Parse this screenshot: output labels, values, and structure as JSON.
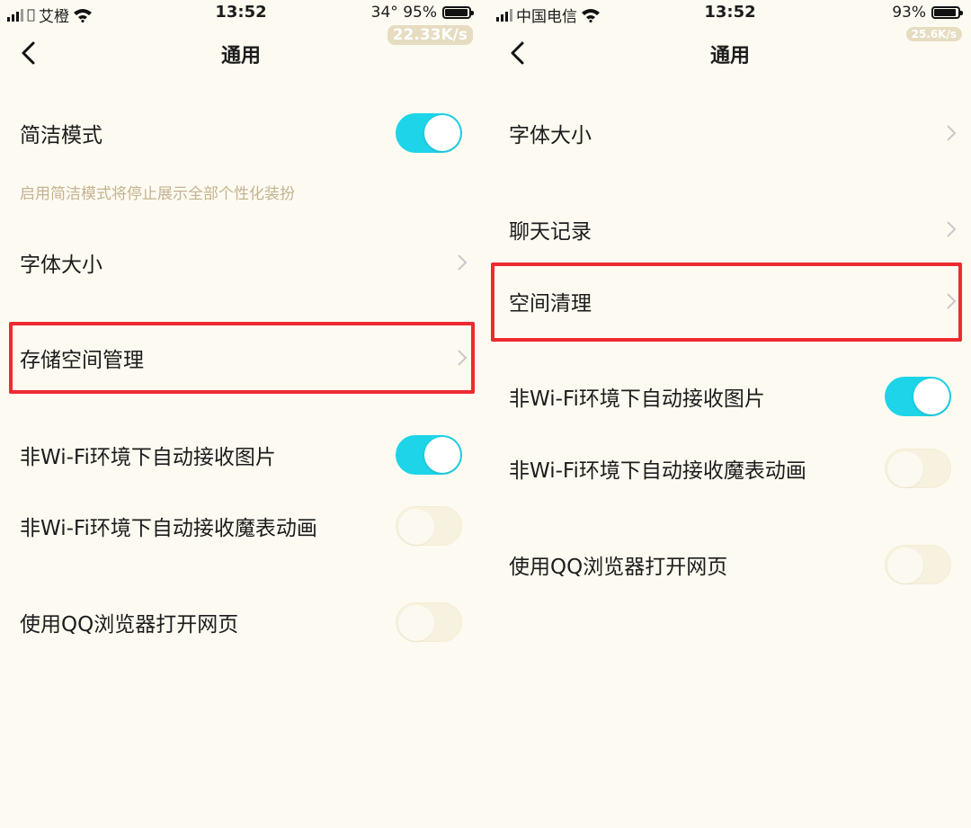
{
  "left": {
    "statusbar": {
      "carrier": "艾橙",
      "time": "13:52",
      "status": "34° 95%",
      "battery_level": 0.95,
      "speed": "22.33K/s"
    },
    "nav": {
      "title": "通用"
    },
    "rows": {
      "simple_mode": {
        "label": "简洁模式",
        "on": true
      },
      "simple_mode_hint": "启用简洁模式将停止展示全部个性化装扮",
      "font_size": {
        "label": "字体大小"
      },
      "storage": {
        "label": "存储空间管理"
      },
      "auto_image": {
        "label": "非Wi-Fi环境下自动接收图片",
        "on": true
      },
      "auto_emoji": {
        "label": "非Wi-Fi环境下自动接收魔表动画",
        "on": false
      },
      "qq_browser": {
        "label": "使用QQ浏览器打开网页",
        "on": false
      }
    }
  },
  "right": {
    "statusbar": {
      "carrier": "中国电信",
      "time": "13:52",
      "status": "93%",
      "battery_level": 0.93,
      "speed": "25.6K/s"
    },
    "nav": {
      "title": "通用"
    },
    "rows": {
      "font_size": {
        "label": "字体大小"
      },
      "chat_history": {
        "label": "聊天记录"
      },
      "space_cleanup": {
        "label": "空间清理"
      },
      "auto_image": {
        "label": "非Wi-Fi环境下自动接收图片",
        "on": true
      },
      "auto_emoji": {
        "label": "非Wi-Fi环境下自动接收魔表动画",
        "on": false
      },
      "qq_browser": {
        "label": "使用QQ浏览器打开网页",
        "on": false
      }
    }
  },
  "colors": {
    "background": "#fdfbf1",
    "toggle_on": "#1ed4e8",
    "highlight": "#ee2a31",
    "hint_text": "#c4b292"
  },
  "icons": [
    "signal-icon",
    "apple-icon",
    "wifi-icon",
    "battery-icon",
    "back-icon",
    "chevron-right-icon"
  ]
}
